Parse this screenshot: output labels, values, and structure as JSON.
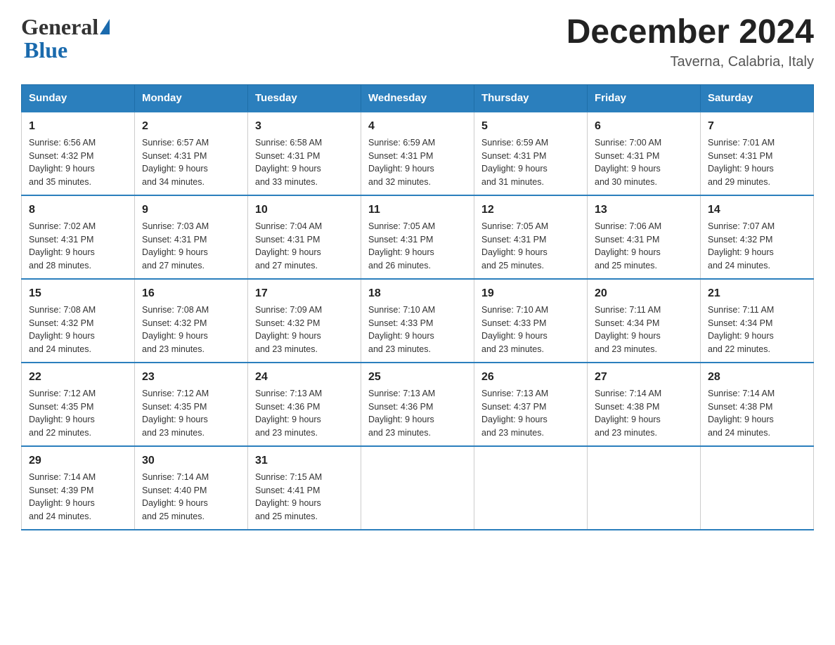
{
  "header": {
    "logo_general": "General",
    "logo_blue": "Blue",
    "month_title": "December 2024",
    "location": "Taverna, Calabria, Italy"
  },
  "days_of_week": [
    "Sunday",
    "Monday",
    "Tuesday",
    "Wednesday",
    "Thursday",
    "Friday",
    "Saturday"
  ],
  "weeks": [
    [
      {
        "day": "1",
        "sunrise": "6:56 AM",
        "sunset": "4:32 PM",
        "daylight": "9 hours and 35 minutes."
      },
      {
        "day": "2",
        "sunrise": "6:57 AM",
        "sunset": "4:31 PM",
        "daylight": "9 hours and 34 minutes."
      },
      {
        "day": "3",
        "sunrise": "6:58 AM",
        "sunset": "4:31 PM",
        "daylight": "9 hours and 33 minutes."
      },
      {
        "day": "4",
        "sunrise": "6:59 AM",
        "sunset": "4:31 PM",
        "daylight": "9 hours and 32 minutes."
      },
      {
        "day": "5",
        "sunrise": "6:59 AM",
        "sunset": "4:31 PM",
        "daylight": "9 hours and 31 minutes."
      },
      {
        "day": "6",
        "sunrise": "7:00 AM",
        "sunset": "4:31 PM",
        "daylight": "9 hours and 30 minutes."
      },
      {
        "day": "7",
        "sunrise": "7:01 AM",
        "sunset": "4:31 PM",
        "daylight": "9 hours and 29 minutes."
      }
    ],
    [
      {
        "day": "8",
        "sunrise": "7:02 AM",
        "sunset": "4:31 PM",
        "daylight": "9 hours and 28 minutes."
      },
      {
        "day": "9",
        "sunrise": "7:03 AM",
        "sunset": "4:31 PM",
        "daylight": "9 hours and 27 minutes."
      },
      {
        "day": "10",
        "sunrise": "7:04 AM",
        "sunset": "4:31 PM",
        "daylight": "9 hours and 27 minutes."
      },
      {
        "day": "11",
        "sunrise": "7:05 AM",
        "sunset": "4:31 PM",
        "daylight": "9 hours and 26 minutes."
      },
      {
        "day": "12",
        "sunrise": "7:05 AM",
        "sunset": "4:31 PM",
        "daylight": "9 hours and 25 minutes."
      },
      {
        "day": "13",
        "sunrise": "7:06 AM",
        "sunset": "4:31 PM",
        "daylight": "9 hours and 25 minutes."
      },
      {
        "day": "14",
        "sunrise": "7:07 AM",
        "sunset": "4:32 PM",
        "daylight": "9 hours and 24 minutes."
      }
    ],
    [
      {
        "day": "15",
        "sunrise": "7:08 AM",
        "sunset": "4:32 PM",
        "daylight": "9 hours and 24 minutes."
      },
      {
        "day": "16",
        "sunrise": "7:08 AM",
        "sunset": "4:32 PM",
        "daylight": "9 hours and 23 minutes."
      },
      {
        "day": "17",
        "sunrise": "7:09 AM",
        "sunset": "4:32 PM",
        "daylight": "9 hours and 23 minutes."
      },
      {
        "day": "18",
        "sunrise": "7:10 AM",
        "sunset": "4:33 PM",
        "daylight": "9 hours and 23 minutes."
      },
      {
        "day": "19",
        "sunrise": "7:10 AM",
        "sunset": "4:33 PM",
        "daylight": "9 hours and 23 minutes."
      },
      {
        "day": "20",
        "sunrise": "7:11 AM",
        "sunset": "4:34 PM",
        "daylight": "9 hours and 23 minutes."
      },
      {
        "day": "21",
        "sunrise": "7:11 AM",
        "sunset": "4:34 PM",
        "daylight": "9 hours and 22 minutes."
      }
    ],
    [
      {
        "day": "22",
        "sunrise": "7:12 AM",
        "sunset": "4:35 PM",
        "daylight": "9 hours and 22 minutes."
      },
      {
        "day": "23",
        "sunrise": "7:12 AM",
        "sunset": "4:35 PM",
        "daylight": "9 hours and 23 minutes."
      },
      {
        "day": "24",
        "sunrise": "7:13 AM",
        "sunset": "4:36 PM",
        "daylight": "9 hours and 23 minutes."
      },
      {
        "day": "25",
        "sunrise": "7:13 AM",
        "sunset": "4:36 PM",
        "daylight": "9 hours and 23 minutes."
      },
      {
        "day": "26",
        "sunrise": "7:13 AM",
        "sunset": "4:37 PM",
        "daylight": "9 hours and 23 minutes."
      },
      {
        "day": "27",
        "sunrise": "7:14 AM",
        "sunset": "4:38 PM",
        "daylight": "9 hours and 23 minutes."
      },
      {
        "day": "28",
        "sunrise": "7:14 AM",
        "sunset": "4:38 PM",
        "daylight": "9 hours and 24 minutes."
      }
    ],
    [
      {
        "day": "29",
        "sunrise": "7:14 AM",
        "sunset": "4:39 PM",
        "daylight": "9 hours and 24 minutes."
      },
      {
        "day": "30",
        "sunrise": "7:14 AM",
        "sunset": "4:40 PM",
        "daylight": "9 hours and 25 minutes."
      },
      {
        "day": "31",
        "sunrise": "7:15 AM",
        "sunset": "4:41 PM",
        "daylight": "9 hours and 25 minutes."
      },
      null,
      null,
      null,
      null
    ]
  ],
  "labels": {
    "sunrise": "Sunrise:",
    "sunset": "Sunset:",
    "daylight": "Daylight:"
  }
}
